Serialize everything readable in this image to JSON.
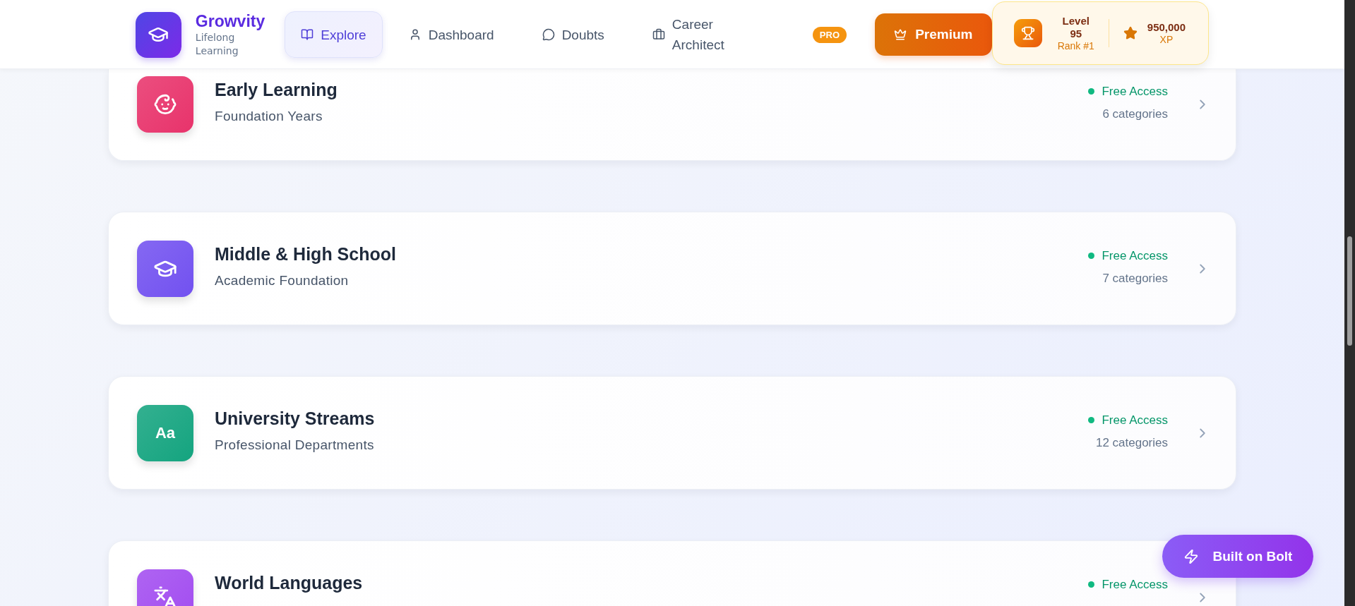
{
  "brand": {
    "name": "Growvity",
    "tagline": "Lifelong Learning"
  },
  "nav": [
    {
      "label": "Explore",
      "selected": true
    },
    {
      "label": "Dashboard",
      "selected": false
    },
    {
      "label": "Doubts",
      "selected": false
    },
    {
      "label": "Career Architect",
      "selected": false,
      "badge": "PRO"
    }
  ],
  "premium_button": "Premium",
  "level_card": {
    "label": "Level",
    "level_value": "95",
    "rank": "Rank #1",
    "xp": "950,000",
    "xp_label": "XP"
  },
  "cards": [
    {
      "title": "Early Learning",
      "subtitle": "Foundation Years",
      "access": "Free Access",
      "count": "6 categories",
      "color": "#e8336b"
    },
    {
      "title": "Middle & High School",
      "subtitle": "Academic Foundation",
      "access": "Free Access",
      "count": "7 categories",
      "color": "#7251f0"
    },
    {
      "title": "University Streams",
      "subtitle": "Professional Departments",
      "access": "Free Access",
      "count": "12 categories",
      "color": "#14a47f",
      "glyph": "Aa"
    },
    {
      "title": "World Languages",
      "access": "Free Access",
      "color": "#a24cf0"
    }
  ],
  "bolt_button": "Built on Bolt"
}
